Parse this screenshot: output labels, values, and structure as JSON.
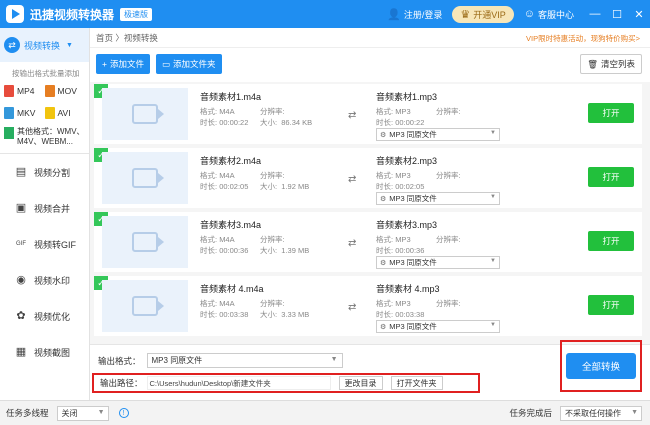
{
  "titlebar": {
    "app_title": "迅捷视频转换器",
    "edition_badge": "极速版",
    "register_login": "注册/登录",
    "vip_label": "开通VIP",
    "support_label": "客服中心",
    "min": "—",
    "max": "☐",
    "close": "✕"
  },
  "sidebar": {
    "active_label": "视频转换",
    "hint": "按输出格式批量添加",
    "formats": [
      {
        "label": "MP4",
        "color": "#e74c3c"
      },
      {
        "label": "MOV",
        "color": "#e67e22"
      },
      {
        "label": "MKV",
        "color": "#3498db"
      },
      {
        "label": "AVI",
        "color": "#f1c40f"
      }
    ],
    "other_formats": "其他格式：WMV、M4V、WEBM...",
    "items": [
      {
        "label": "视频分割",
        "icon": "scissors-icon",
        "glyph": "▤"
      },
      {
        "label": "视频合并",
        "icon": "merge-icon",
        "glyph": "▣"
      },
      {
        "label": "视频转GIF",
        "icon": "gif-icon",
        "glyph": "GIF"
      },
      {
        "label": "视频水印",
        "icon": "watermark-icon",
        "glyph": "◉"
      },
      {
        "label": "视频优化",
        "icon": "optimize-icon",
        "glyph": "✿"
      },
      {
        "label": "视频截图",
        "icon": "screenshot-icon",
        "glyph": "▦"
      }
    ]
  },
  "main": {
    "breadcrumb": "首页 〉视频转换",
    "promo": "VIP限时特惠活动，现狗特价购买>",
    "add_file": "添加文件",
    "add_folder": "添加文件夹",
    "clear_list": "清空列表"
  },
  "files": [
    {
      "src_name": "音频素材1.m4a",
      "src_format": "M4A",
      "src_duration": "00:00:22",
      "src_size": "86.34 KB",
      "dst_name": "音频素材1.mp3",
      "dst_format": "MP3",
      "dst_duration": "00:00:22",
      "preset": "MP3  同原文件"
    },
    {
      "src_name": "音频素材2.m4a",
      "src_format": "M4A",
      "src_duration": "00:02:05",
      "src_size": "1.92 MB",
      "dst_name": "音频素材2.mp3",
      "dst_format": "MP3",
      "dst_duration": "00:02:05",
      "preset": "MP3  同原文件"
    },
    {
      "src_name": "音频素材3.m4a",
      "src_format": "M4A",
      "src_duration": "00:00:36",
      "src_size": "1.39 MB",
      "dst_name": "音频素材3.mp3",
      "dst_format": "MP3",
      "dst_duration": "00:00:36",
      "preset": "MP3  同原文件"
    },
    {
      "src_name": "音频素材 4.m4a",
      "src_format": "M4A",
      "src_duration": "00:03:38",
      "src_size": "3.33 MB",
      "dst_name": "音频素材 4.mp3",
      "dst_format": "MP3",
      "dst_duration": "00:03:38",
      "preset": "MP3  同原文件"
    }
  ],
  "labels": {
    "format": "格式:",
    "resolution": "分辨率:",
    "duration": "时长:",
    "size": "大小:",
    "open": "打开"
  },
  "bottom": {
    "output_format_label": "输出格式：",
    "output_format_value": "MP3  同原文件",
    "output_path_label": "输出路径：",
    "output_path_value": "C:\\Users\\hudun\\Desktop\\新建文件夹",
    "change_dir": "更改目录",
    "open_folder": "打开文件夹",
    "convert_all": "全部转换"
  },
  "statusbar": {
    "multithread_label": "任务多线程",
    "multithread_value": "关闭",
    "complete_label": "任务完成后",
    "complete_value": "不采取任何操作"
  }
}
